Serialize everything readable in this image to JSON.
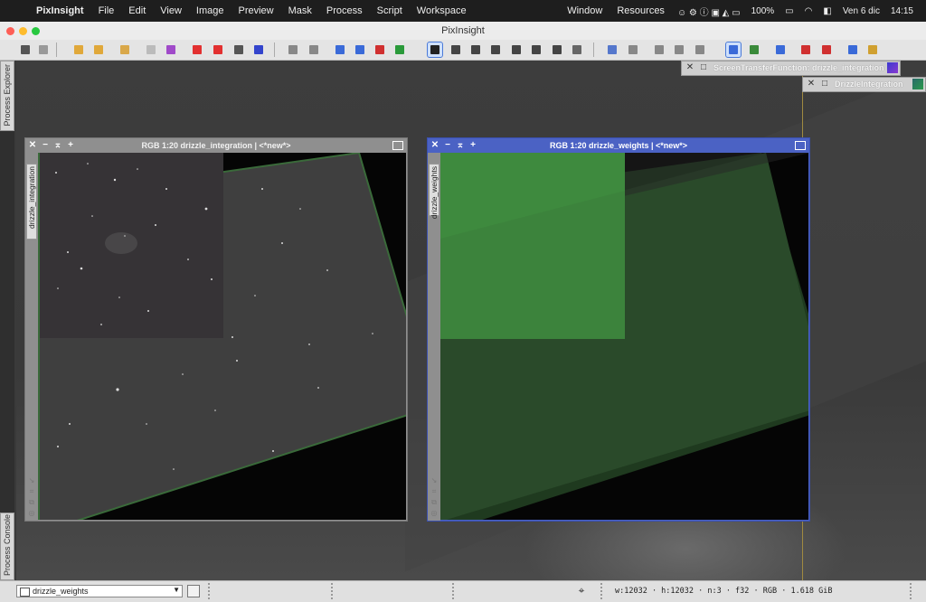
{
  "menubar": {
    "app_name": "PixInsight",
    "menus": [
      "File",
      "Edit",
      "View",
      "Image",
      "Preview",
      "Mask",
      "Process",
      "Script",
      "Workspace"
    ],
    "right_menus": [
      "Window",
      "Resources"
    ],
    "battery": "100%",
    "date": "Ven 6 dic",
    "time": "14:15"
  },
  "window": {
    "title": "PixInsight"
  },
  "side_panels": {
    "process_explorer": "Process Explorer",
    "process_console": "Process Console"
  },
  "floating_panels": [
    {
      "title": "ScreenTransferFunction: drizzle_integration"
    },
    {
      "title": "DrizzleIntegration"
    }
  ],
  "image_windows": [
    {
      "title": "RGB 1:20 drizzle_integration | <*new*>",
      "vertical_label": "drizzle_integration",
      "active": false
    },
    {
      "title": "RGB 1:20 drizzle_weights | <*new*>",
      "vertical_label": "drizzle_weights",
      "active": true
    }
  ],
  "statusbar": {
    "selected_view": "drizzle_weights",
    "image_info": "w:12032 · h:12032 · n:3 · f32 · RGB · 1.618 GiB"
  },
  "colors": {
    "active_titlebar": "#4b62c4",
    "inactive_titlebar": "#8f8f8f",
    "weights_green": "#3e8a3e"
  }
}
